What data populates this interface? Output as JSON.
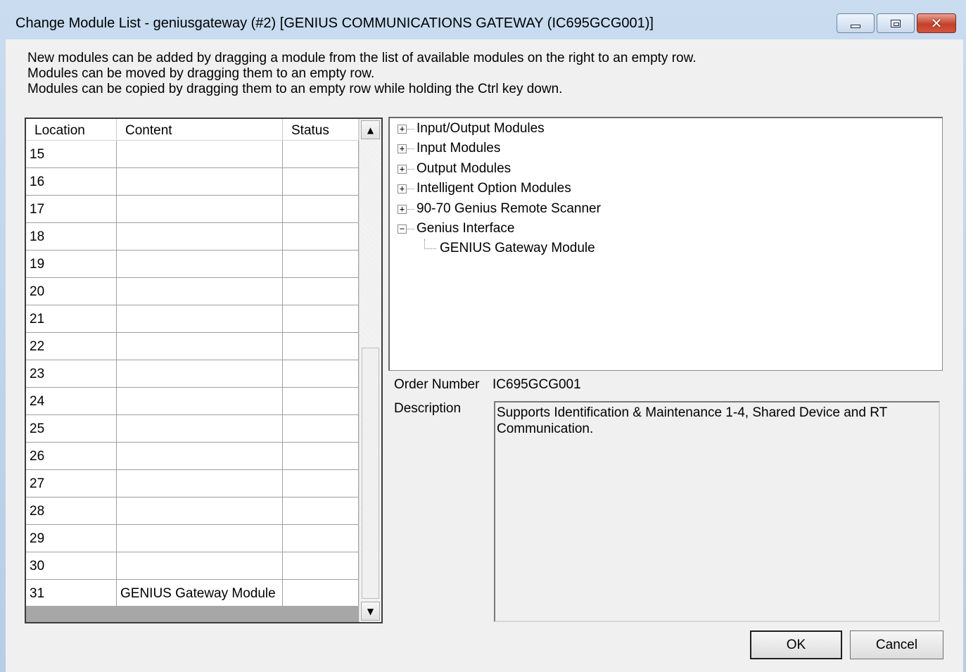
{
  "window": {
    "title": "Change Module List - geniusgateway (#2) [GENIUS COMMUNICATIONS GATEWAY (IC695GCG001)]"
  },
  "instructions": [
    "New modules can be added by dragging a module from the list of available modules on the right to an empty row.",
    "Modules can be moved by dragging them to an empty row.",
    "Modules can be copied by dragging them to an empty row while holding the Ctrl key down."
  ],
  "grid": {
    "columns": [
      "Location",
      "Content",
      "Status"
    ],
    "rows": [
      {
        "location": "15",
        "content": "",
        "status": ""
      },
      {
        "location": "16",
        "content": "",
        "status": ""
      },
      {
        "location": "17",
        "content": "",
        "status": ""
      },
      {
        "location": "18",
        "content": "",
        "status": ""
      },
      {
        "location": "19",
        "content": "",
        "status": ""
      },
      {
        "location": "20",
        "content": "",
        "status": ""
      },
      {
        "location": "21",
        "content": "",
        "status": ""
      },
      {
        "location": "22",
        "content": "",
        "status": ""
      },
      {
        "location": "23",
        "content": "",
        "status": ""
      },
      {
        "location": "24",
        "content": "",
        "status": ""
      },
      {
        "location": "25",
        "content": "",
        "status": ""
      },
      {
        "location": "26",
        "content": "",
        "status": ""
      },
      {
        "location": "27",
        "content": "",
        "status": ""
      },
      {
        "location": "28",
        "content": "",
        "status": ""
      },
      {
        "location": "29",
        "content": "",
        "status": ""
      },
      {
        "location": "30",
        "content": "",
        "status": ""
      },
      {
        "location": "31",
        "content": "GENIUS Gateway Module",
        "status": ""
      }
    ]
  },
  "tree": {
    "items": [
      {
        "label": "Input/Output Modules",
        "expander": "+"
      },
      {
        "label": "Input Modules",
        "expander": "+"
      },
      {
        "label": "Output Modules",
        "expander": "+"
      },
      {
        "label": "Intelligent Option Modules",
        "expander": "+"
      },
      {
        "label": "90-70 Genius Remote Scanner",
        "expander": "+"
      },
      {
        "label": "Genius Interface",
        "expander": "−"
      }
    ],
    "child_label": "GENIUS Gateway Module"
  },
  "details": {
    "order_number_label": "Order Number",
    "order_number_value": "IC695GCG001",
    "description_label": "Description",
    "description_value": "Supports Identification & Maintenance 1-4, Shared Device and RT Communication."
  },
  "buttons": {
    "ok": "OK",
    "cancel": "Cancel"
  },
  "icons": {
    "minimize": "minimize-icon",
    "maximize": "maximize-icon",
    "close": "close-icon",
    "close_glyph": "✕",
    "scroll_up": "▲",
    "scroll_down": "▼"
  },
  "colors": {
    "dialog_bg": "#f0f0f0",
    "titlebar": "#c9dcf0",
    "close_button": "#c6402a"
  }
}
